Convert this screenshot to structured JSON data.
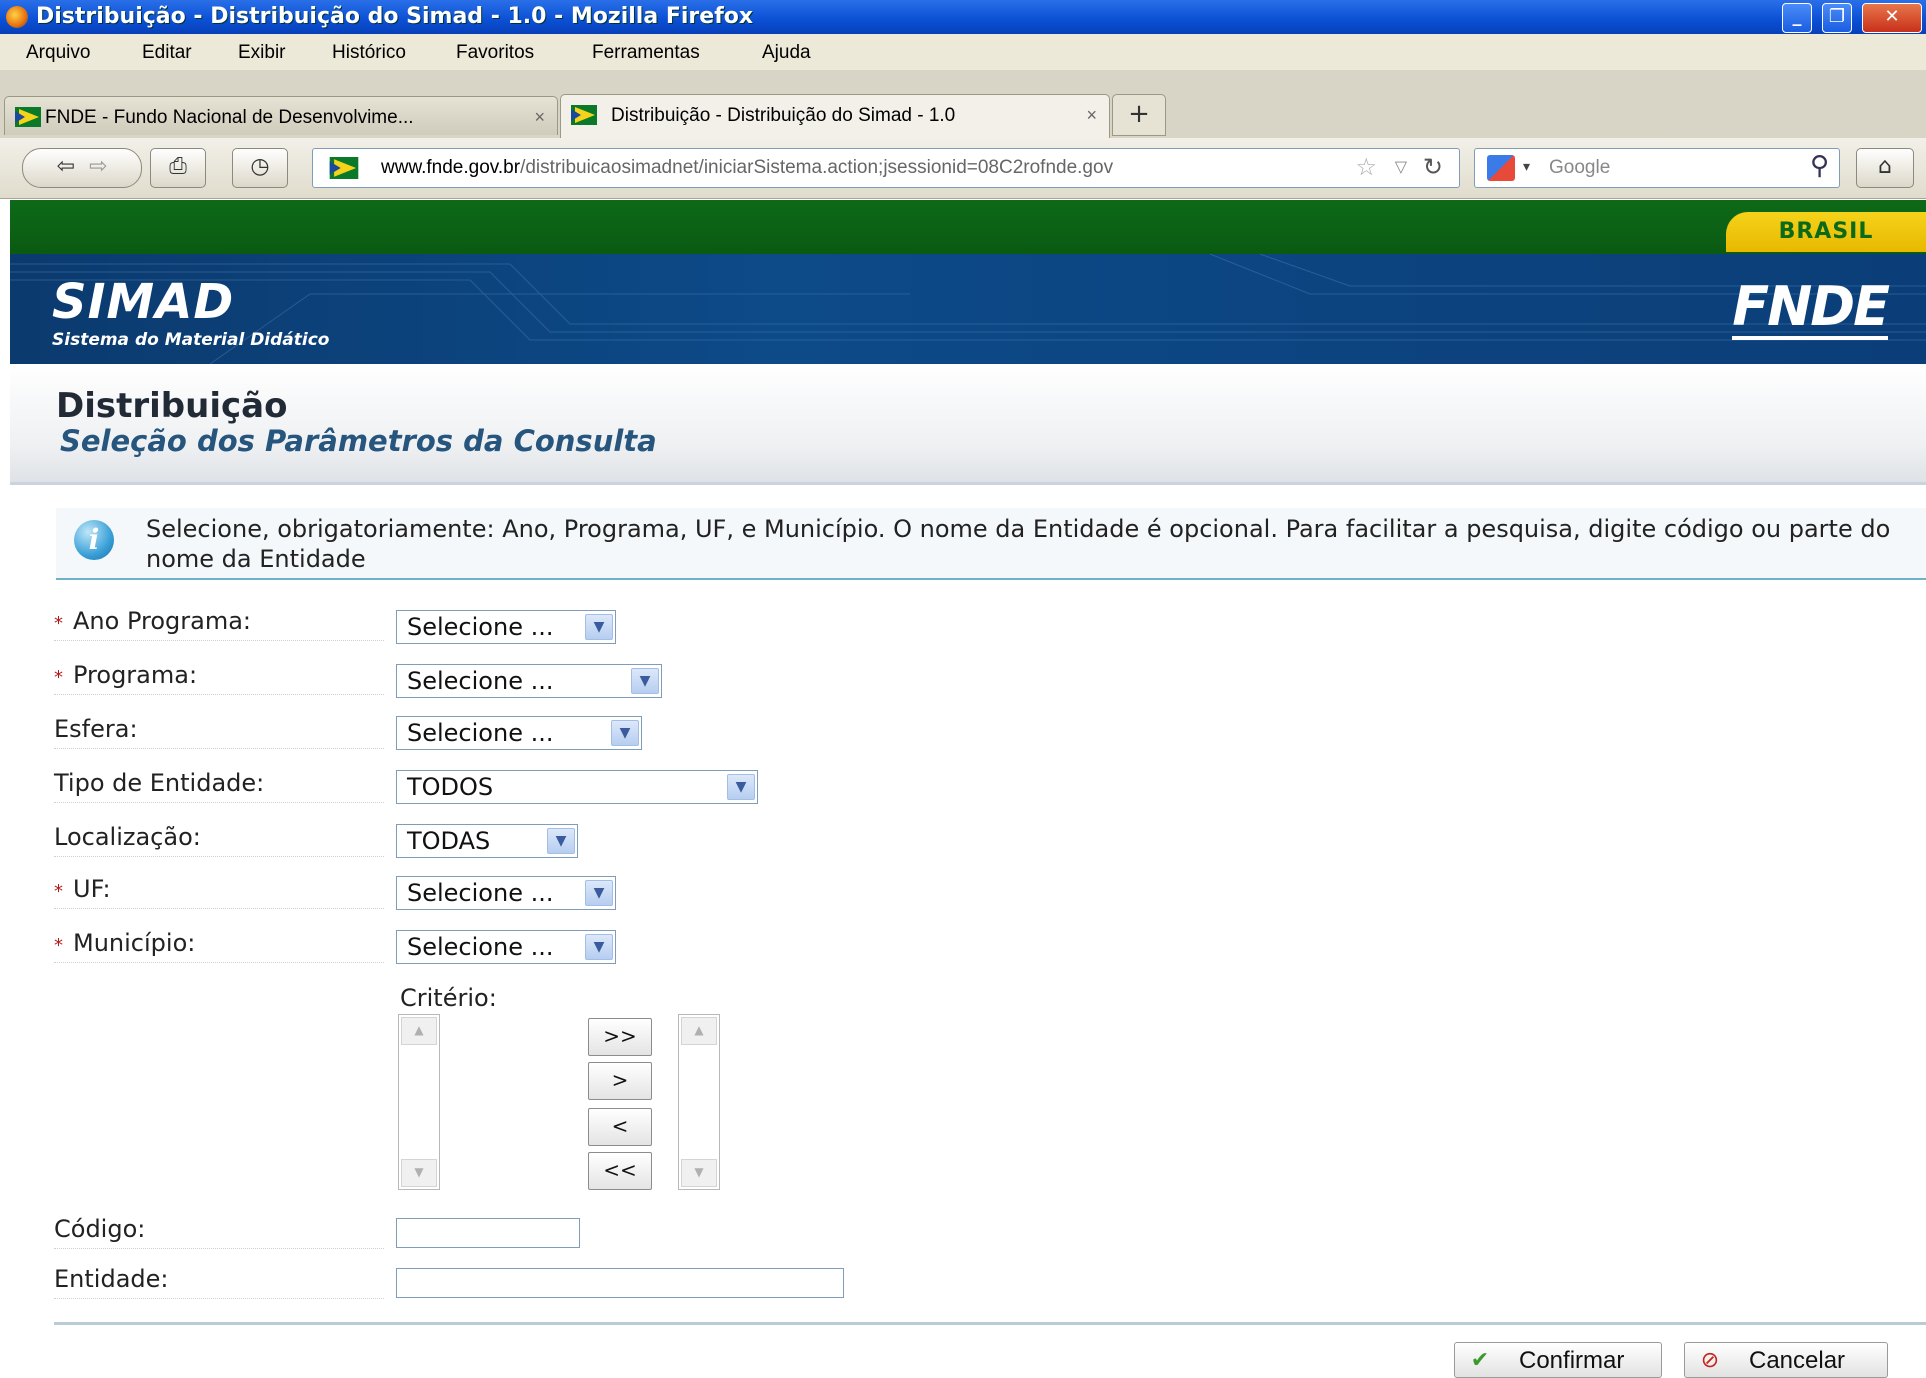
{
  "window": {
    "title": "Distribuição - Distribuição do Simad - 1.0 - Mozilla Firefox"
  },
  "menu": [
    "Arquivo",
    "Editar",
    "Exibir",
    "Histórico",
    "Favoritos",
    "Ferramentas",
    "Ajuda"
  ],
  "tabs": [
    {
      "label": "FNDE - Fundo Nacional de Desenvolvime...",
      "close": "×"
    },
    {
      "label": "Distribuição - Distribuição do Simad - 1.0",
      "close": "×"
    }
  ],
  "newtab": "+",
  "nav": {
    "url_domain": "www.fnde.gov.br",
    "url_path": "/distribuicaosimadnet/iniciarSistema.action;jsessionid=08C2rofnde.gov",
    "search_placeholder": "Google"
  },
  "gov": {
    "brasil": "BRASIL"
  },
  "banner": {
    "title": "SIMAD",
    "subtitle": "Sistema do Material Didático",
    "logo": "FNDE"
  },
  "page": {
    "title": "Distribuição",
    "subtitle": "Seleção dos Parâmetros da Consulta"
  },
  "info": {
    "text": "Selecione, obrigatoriamente: Ano, Programa, UF, e Município. O nome da Entidade é opcional. Para facilitar a pesquisa, digite código ou parte do nome da Entidade"
  },
  "form": {
    "ano": {
      "label": "Ano Programa:",
      "value": "Selecione ..."
    },
    "programa": {
      "label": "Programa:",
      "value": "Selecione ..."
    },
    "esfera": {
      "label": "Esfera:",
      "value": "Selecione ..."
    },
    "tipo": {
      "label": "Tipo de Entidade:",
      "value": "TODOS"
    },
    "localizacao": {
      "label": "Localização:",
      "value": "TODAS"
    },
    "uf": {
      "label": "UF:",
      "value": "Selecione ..."
    },
    "municipio": {
      "label": "Município:",
      "value": "Selecione ..."
    },
    "criterio": {
      "label": "Critério:",
      "buttons": [
        ">>",
        ">",
        "<",
        "<<"
      ]
    },
    "codigo": {
      "label": "Código:",
      "value": ""
    },
    "entidade": {
      "label": "Entidade:",
      "value": ""
    },
    "required_mark": "*"
  },
  "actions": {
    "confirm": "Confirmar",
    "cancel": "Cancelar"
  }
}
